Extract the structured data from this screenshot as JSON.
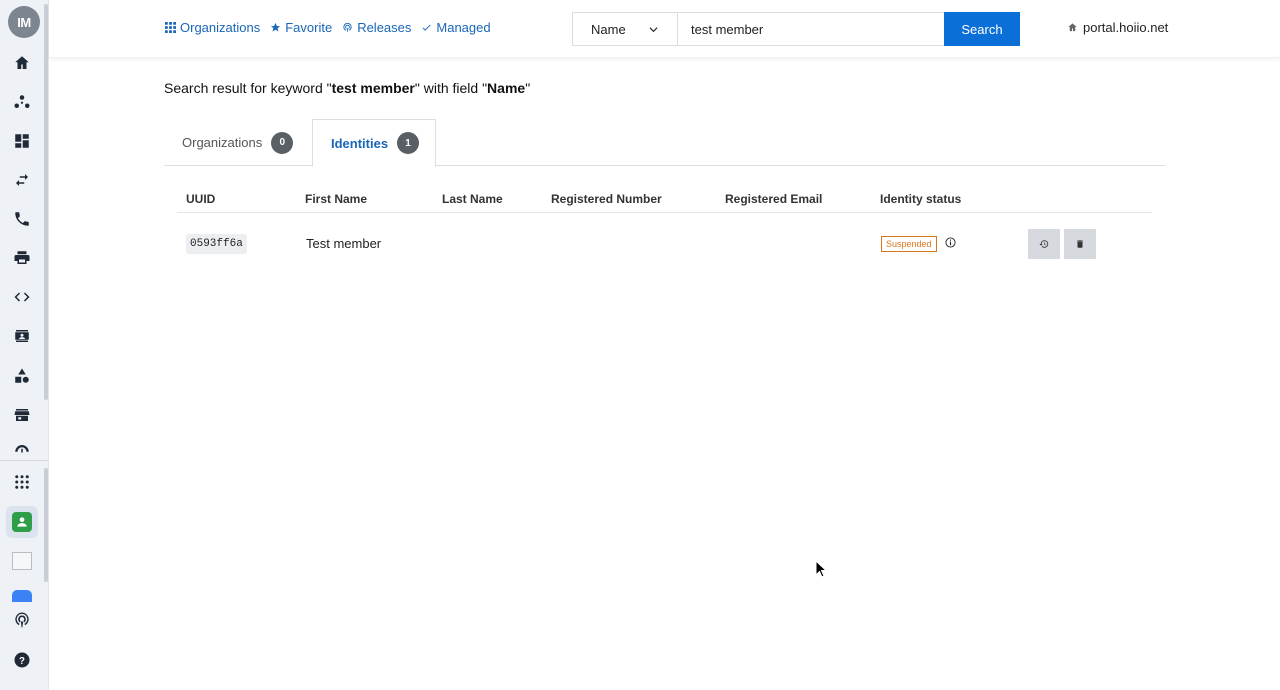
{
  "sidebar": {
    "avatar_initials": "IM",
    "nav_icons": [
      "home-icon",
      "hub-icon",
      "dashboard-icon",
      "transfer-icon",
      "phone-icon",
      "printer-icon",
      "code-icon",
      "contact-card-icon",
      "shapes-icon",
      "store-icon",
      "gauge-icon"
    ],
    "bottom_icons": [
      "apps-grid-icon",
      "active-app-icon",
      "broken-image-icon",
      "blue-app-icon",
      "podcast-icon",
      "help-icon"
    ]
  },
  "topnav": {
    "organizations": "Organizations",
    "favorite": "Favorite",
    "releases": "Releases",
    "managed": "Managed"
  },
  "search": {
    "field": "Name",
    "value": "test member",
    "button": "Search"
  },
  "portal": "portal.hoiio.net",
  "result": {
    "prefix": "Search result for keyword \"",
    "keyword": "test member",
    "middle": "\" with field \"",
    "field": "Name",
    "suffix": "\""
  },
  "tabs": [
    {
      "label": "Organizations",
      "count": "0"
    },
    {
      "label": "Identities",
      "count": "1"
    }
  ],
  "table": {
    "columns": [
      "UUID",
      "First Name",
      "Last Name",
      "Registered Number",
      "Registered Email",
      "Identity status"
    ],
    "rows": [
      {
        "uuid": "0593ff6a",
        "first_name": "Test member",
        "last_name": "",
        "number": "",
        "email": "",
        "status": "Suspended"
      }
    ]
  },
  "colors": {
    "accent": "#0a6fd6",
    "link": "#1a66b8",
    "status_suspended": "#d9771e"
  }
}
